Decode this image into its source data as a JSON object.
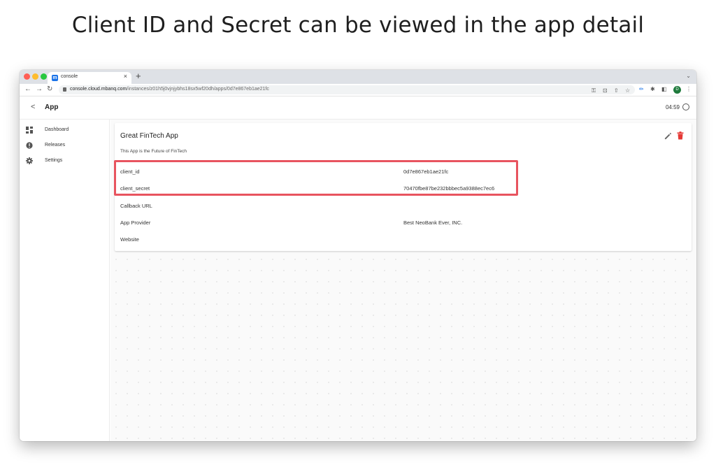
{
  "caption": "Client ID and Secret can be viewed in the app detail",
  "browser": {
    "tab_title": "console",
    "tab_close": "×",
    "new_tab": "+",
    "url_host": "console.cloud.mbanq.com",
    "url_path": "/instances/z01h5j0vjnjybhs18sx5wf20dh/apps/0d7e867eb1ae21fc",
    "profile_initial": "D"
  },
  "app": {
    "back_symbol": "<",
    "title": "App",
    "time": "04:59"
  },
  "sidebar": {
    "items": [
      {
        "label": "Dashboard",
        "icon": "dashboard-icon"
      },
      {
        "label": "Releases",
        "icon": "releases-icon"
      },
      {
        "label": "Settings",
        "icon": "gear-icon"
      }
    ]
  },
  "card": {
    "title": "Great FinTech App",
    "description": "This App is the Future of FinTech",
    "rows": [
      {
        "label": "client_id",
        "value": "0d7e867eb1ae21fc"
      },
      {
        "label": "client_secret",
        "value": "70470fbe87be232bbbec5a9388ec7ec6"
      },
      {
        "label": "Callback URL",
        "value": ""
      },
      {
        "label": "App Provider",
        "value": "Best NeoBank Ever, INC."
      },
      {
        "label": "Website",
        "value": ""
      }
    ]
  },
  "colors": {
    "highlight": "#e8545f",
    "delete": "#e53935",
    "profile": "#1e7a3c"
  }
}
